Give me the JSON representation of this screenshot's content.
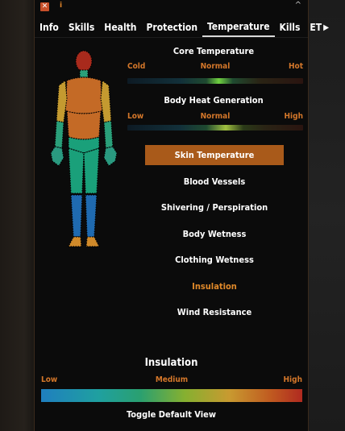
{
  "window": {
    "close_label": "✕",
    "info_label": "i",
    "collapse_label": "^"
  },
  "tabs": [
    {
      "label": "Info",
      "active": false
    },
    {
      "label": "Skills",
      "active": false
    },
    {
      "label": "Health",
      "active": false
    },
    {
      "label": "Protection",
      "active": false
    },
    {
      "label": "Temperature",
      "active": true
    },
    {
      "label": "Kills",
      "active": false
    },
    {
      "label": "ET",
      "active": false
    }
  ],
  "tab_more_icon": "triangle-right",
  "core_temperature": {
    "title": "Core Temperature",
    "low": "Cold",
    "mid": "Normal",
    "high": "Hot",
    "marker_fraction": 0.52
  },
  "body_heat": {
    "title": "Body Heat Generation",
    "low": "Low",
    "mid": "Normal",
    "high": "High",
    "marker_fraction": 0.56
  },
  "menu": [
    {
      "label": "Skin Temperature",
      "state": "selected"
    },
    {
      "label": "Blood Vessels",
      "state": "normal"
    },
    {
      "label": "Shivering / Perspiration",
      "state": "normal"
    },
    {
      "label": "Body Wetness",
      "state": "normal"
    },
    {
      "label": "Clothing Wetness",
      "state": "normal"
    },
    {
      "label": "Insulation",
      "state": "highlight"
    },
    {
      "label": "Wind Resistance",
      "state": "normal"
    }
  ],
  "insulation_scale": {
    "title": "Insulation",
    "low": "Low",
    "mid": "Medium",
    "high": "High"
  },
  "toggle_label": "Toggle Default View",
  "colors": {
    "accent": "#a95a1a",
    "label_orange": "#d4772a",
    "head": "#a82a1c",
    "torso": "#c46a26",
    "upper_arm": "#c49a30",
    "forearm": "#2aa07a",
    "hands": "#2a9a80",
    "thighs": "#1aa07a",
    "shins": "#1f6ab0",
    "feet": "#d08a2a"
  }
}
